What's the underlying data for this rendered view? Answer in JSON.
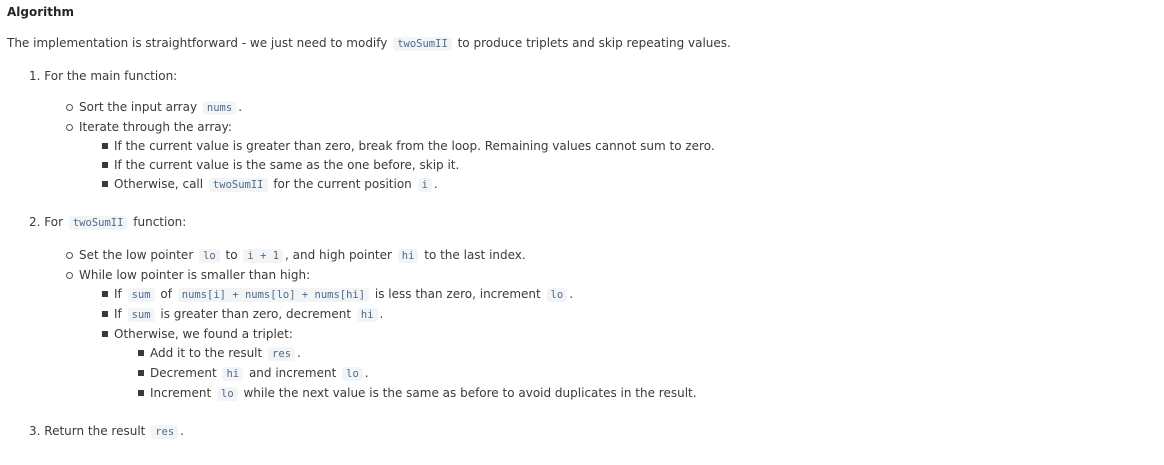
{
  "title": "Algorithm",
  "intro": {
    "pre": "The implementation is straightforward - we just need to modify ",
    "code": "twoSumII",
    "post": " to produce triplets and skip repeating values."
  },
  "steps": [
    {
      "num": "1.",
      "text": "For the main function:"
    },
    {
      "num": "2.",
      "pre": "For ",
      "code": "twoSumII",
      "post": " function:"
    },
    {
      "num": "3.",
      "pre": "Return the result ",
      "code": "res",
      "post": "."
    }
  ],
  "step1": {
    "sort": {
      "pre": "Sort the input array ",
      "code": "nums",
      "post": "."
    },
    "iterate": "Iterate through the array:",
    "b1": "If the current value is greater than zero, break from the loop. Remaining values cannot sum to zero.",
    "b2": "If the current value is the same as the one before, skip it.",
    "b3": {
      "pre": "Otherwise, call ",
      "code": "twoSumII",
      "mid": " for the current position ",
      "code2": "i",
      "post": "."
    }
  },
  "step2": {
    "set": {
      "pre": "Set the low pointer ",
      "c1": "lo",
      "m1": " to ",
      "c2": "i + 1",
      "m2": ", and high pointer ",
      "c3": "hi",
      "post": " to the last index."
    },
    "while": "While low pointer is smaller than high:",
    "b1": {
      "pre": "If ",
      "c1": "sum",
      "m1": " of ",
      "c2": "nums[i] + nums[lo] + nums[hi]",
      "m2": " is less than zero, increment ",
      "c3": "lo",
      "post": "."
    },
    "b2": {
      "pre": "If ",
      "c1": "sum",
      "m1": " is greater than zero, decrement ",
      "c2": "hi",
      "post": "."
    },
    "b3": "Otherwise, we found a triplet:",
    "t1": {
      "pre": "Add it to the result ",
      "code": "res",
      "post": "."
    },
    "t2": {
      "pre": "Decrement ",
      "c1": "hi",
      "m1": " and increment ",
      "c2": "lo",
      "post": "."
    },
    "t3": {
      "pre": "Increment ",
      "code": "lo",
      "post": " while the next value is the same as before to avoid duplicates in the result."
    }
  }
}
